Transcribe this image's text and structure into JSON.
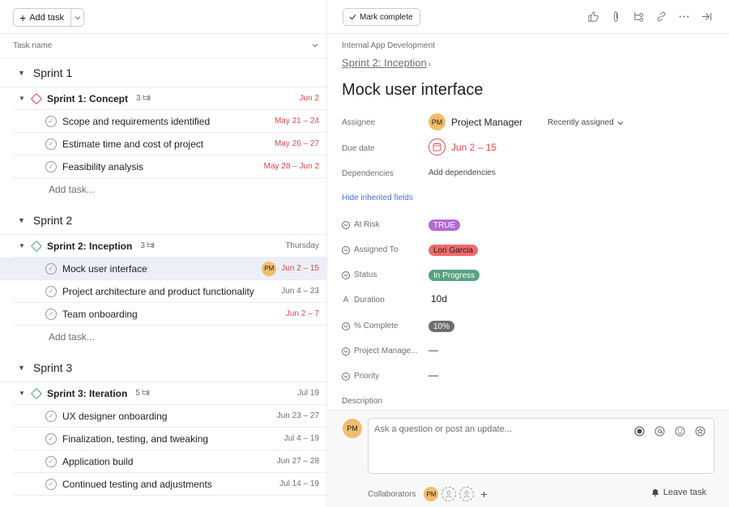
{
  "list": {
    "add_task_label": "Add task",
    "column_header": "Task name",
    "add_task_link": "Add task...",
    "sections": [
      {
        "title": "Sprint 1",
        "parent": {
          "name": "Sprint 1: Concept",
          "subtask_count": "3",
          "date": "Jun 2",
          "date_overdue": true,
          "milestone_color": "#e0474e"
        },
        "tasks": [
          {
            "name": "Scope and requirements identified",
            "date": "May 21 – 24",
            "overdue": true
          },
          {
            "name": "Estimate time and cost of project",
            "date": "May 26 – 27",
            "overdue": true
          },
          {
            "name": "Feasibility analysis",
            "date": "May 28 – Jun 2",
            "overdue": true
          }
        ]
      },
      {
        "title": "Sprint 2",
        "parent": {
          "name": "Sprint 2: Inception",
          "subtask_count": "3",
          "date": "Thursday",
          "date_overdue": false,
          "milestone_color": "#58a182"
        },
        "tasks": [
          {
            "name": "Mock user interface",
            "date": "Jun 2 – 15",
            "overdue": true,
            "selected": true,
            "assignee_initials": "PM"
          },
          {
            "name": "Project architecture and product functionality",
            "date": "Jun 4 – 23",
            "overdue": false
          },
          {
            "name": "Team onboarding",
            "date": "Jun 2 – 7",
            "overdue": true
          }
        ]
      },
      {
        "title": "Sprint 3",
        "parent": {
          "name": "Sprint 3: Iteration",
          "subtask_count": "5",
          "date": "Jul 19",
          "date_overdue": false,
          "milestone_color": "#58a182"
        },
        "tasks": [
          {
            "name": "UX designer onboarding",
            "date": "Jun 23 – 27",
            "overdue": false
          },
          {
            "name": "Finalization, testing, and tweaking",
            "date": "Jul 4 – 19",
            "overdue": false
          },
          {
            "name": "Application build",
            "date": "Jun 27 – 28",
            "overdue": false
          },
          {
            "name": "Continued testing and adjustments",
            "date": "Jul 14 – 19",
            "overdue": false
          }
        ]
      }
    ]
  },
  "detail": {
    "mark_complete_label": "Mark complete",
    "toolbar_icons": [
      "like-icon",
      "attachment-icon",
      "subtask-icon",
      "link-icon",
      "more-icon",
      "close-pane-icon"
    ],
    "project": "Internal App Development",
    "parent_task": "Sprint 2: Inception",
    "title": "Mock user interface",
    "fields": {
      "assignee_label": "Assignee",
      "assignee_initials": "PM",
      "assignee_name": "Project Manager",
      "recently_assigned": "Recently assigned",
      "due_label": "Due date",
      "due_value": "Jun 2 – 15",
      "dependencies_label": "Dependencies",
      "add_dependencies": "Add dependencies",
      "hide_inherited": "Hide inherited fields"
    },
    "custom_fields": [
      {
        "label": "At Risk",
        "value": "TRUE",
        "type": "pill",
        "bg": "#b36bd4",
        "fg": "#ffffff"
      },
      {
        "label": "Assigned To",
        "value": "Lori Garcia",
        "type": "pill",
        "bg": "#f06a6a",
        "fg": "#1e1f21"
      },
      {
        "label": "Status",
        "value": "In Progress",
        "type": "pill",
        "bg": "#58a182",
        "fg": "#ffffff"
      },
      {
        "label": "Duration",
        "value": "10d",
        "type": "text"
      },
      {
        "label": "% Complete",
        "value": "10%",
        "type": "pill",
        "bg": "#6d6e6f",
        "fg": "#ffffff"
      },
      {
        "label": "Project Manage...",
        "value": "—",
        "type": "text"
      },
      {
        "label": "Priority",
        "value": "—",
        "type": "text"
      }
    ],
    "description_label": "Description",
    "comment": {
      "avatar_initials": "PM",
      "placeholder": "Ask a question or post an update...",
      "collaborators_label": "Collaborators",
      "collaborator_initials": "PM",
      "leave_task_label": "Leave task"
    }
  },
  "colors": {
    "overdue": "#e0474e",
    "avatar": "#f1bd6c",
    "link": "#4573d2",
    "selected_row": "#edeff8"
  }
}
